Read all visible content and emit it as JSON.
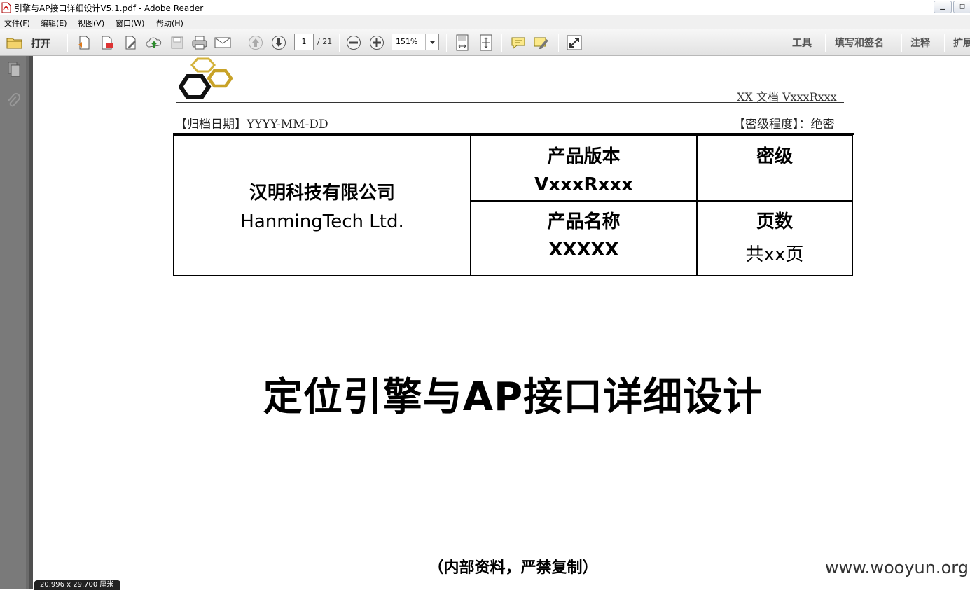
{
  "window": {
    "title": "引擎与AP接口详细设计V5.1.pdf - Adobe Reader"
  },
  "menu": [
    "文件(F)",
    "编辑(E)",
    "视图(V)",
    "窗口(W)",
    "帮助(H)"
  ],
  "toolbar": {
    "open_label": "打开",
    "page_current": "1",
    "page_total": "/ 21",
    "zoom": "151%",
    "right_links": [
      "工具",
      "填写和签名",
      "注释",
      "扩展"
    ]
  },
  "document": {
    "header_right": "XX 文档 VxxxRxxx",
    "archive_date": "【归档日期】YYYY-MM-DD",
    "secrecy_level": "【密级程度】：绝密",
    "table": {
      "company_cn": "汉明科技有限公司",
      "company_en": "HanmingTech Ltd.",
      "version_label": "产品版本",
      "version_value": "VxxxRxxx",
      "secret_label": "密级",
      "secret_value": "",
      "name_label": "产品名称",
      "name_value": "XXXXX",
      "pages_label": "页数",
      "pages_value": "共xx页"
    },
    "title": "定位引擎与AP接口详细设计",
    "footer_note": "（内部资料，严禁复制）",
    "watermark": "www.wooyun.org"
  },
  "status": {
    "page_size": "20.996 x 29.700 厘米"
  },
  "colors": {
    "logo_gold": "#c8a227",
    "logo_black": "#111111",
    "sidebar": "#6b6b6b"
  }
}
